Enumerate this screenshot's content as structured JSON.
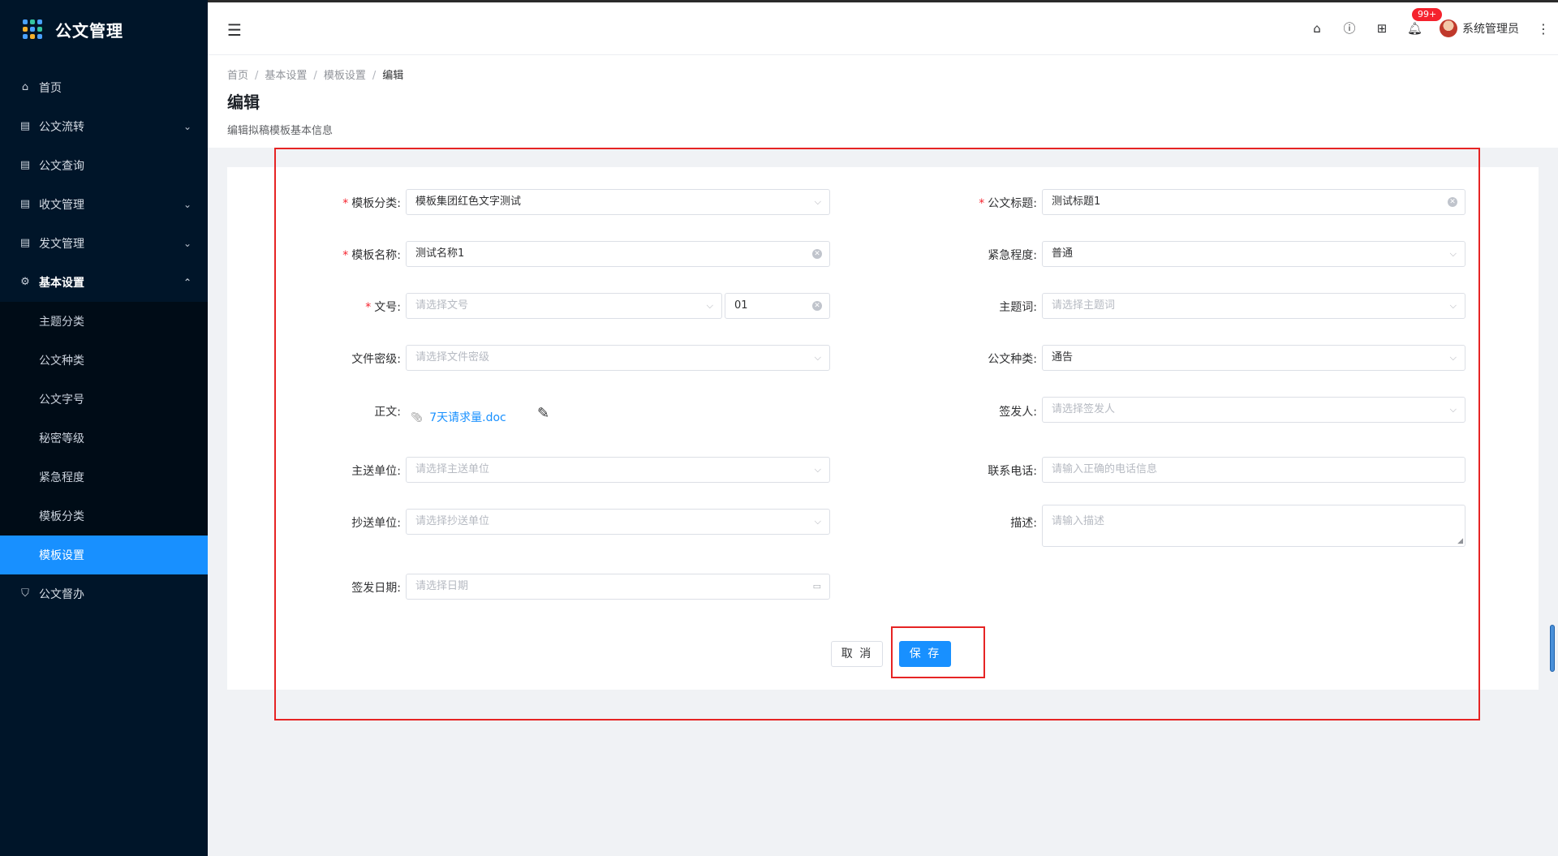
{
  "app": {
    "title": "公文管理"
  },
  "sidebar": {
    "items": [
      {
        "label": "首页",
        "icon": "home-icon"
      },
      {
        "label": "公文流转",
        "icon": "document-flow-icon"
      },
      {
        "label": "公文查询",
        "icon": "document-search-icon"
      },
      {
        "label": "收文管理",
        "icon": "inbox-document-icon"
      },
      {
        "label": "发文管理",
        "icon": "send-document-icon"
      },
      {
        "label": "基本设置",
        "icon": "gear-icon"
      },
      {
        "label": "公文督办",
        "icon": "shield-icon"
      }
    ],
    "submenu": [
      {
        "label": "主题分类"
      },
      {
        "label": "公文种类"
      },
      {
        "label": "公文字号"
      },
      {
        "label": "秘密等级"
      },
      {
        "label": "紧急程度"
      },
      {
        "label": "模板分类"
      },
      {
        "label": "模板设置"
      }
    ]
  },
  "header": {
    "notification_count": "99+",
    "username": "系统管理员"
  },
  "breadcrumb": [
    "首页",
    "基本设置",
    "模板设置",
    "编辑"
  ],
  "page": {
    "title": "编辑",
    "description": "编辑拟稿模板基本信息"
  },
  "form": {
    "template_category": {
      "label": "模板分类:",
      "value": "模板集团红色文字测试"
    },
    "template_name": {
      "label": "模板名称:",
      "value": "测试名称1"
    },
    "doc_number": {
      "label": "文号:",
      "placeholder": "请选择文号",
      "seq": "01"
    },
    "secrecy": {
      "label": "文件密级:",
      "placeholder": "请选择文件密级"
    },
    "body": {
      "label": "正文:",
      "file": "7天请求量.doc"
    },
    "main_recipient": {
      "label": "主送单位:",
      "placeholder": "请选择主送单位"
    },
    "cc_recipient": {
      "label": "抄送单位:",
      "placeholder": "请选择抄送单位"
    },
    "issue_date": {
      "label": "签发日期:",
      "placeholder": "请选择日期"
    },
    "doc_title": {
      "label": "公文标题:",
      "value": "测试标题1"
    },
    "urgency": {
      "label": "紧急程度:",
      "value": "普通"
    },
    "keyword": {
      "label": "主题词:",
      "placeholder": "请选择主题词"
    },
    "doc_type": {
      "label": "公文种类:",
      "value": "通告"
    },
    "signer": {
      "label": "签发人:",
      "placeholder": "请选择签发人"
    },
    "phone": {
      "label": "联系电话:",
      "placeholder": "请输入正确的电话信息"
    },
    "description": {
      "label": "描述:",
      "placeholder": "请输入描述"
    }
  },
  "buttons": {
    "cancel": "取 消",
    "save": "保 存"
  },
  "colors": {
    "primary": "#1890ff",
    "sidebar": "#001529",
    "highlight_box": "#e62424"
  }
}
